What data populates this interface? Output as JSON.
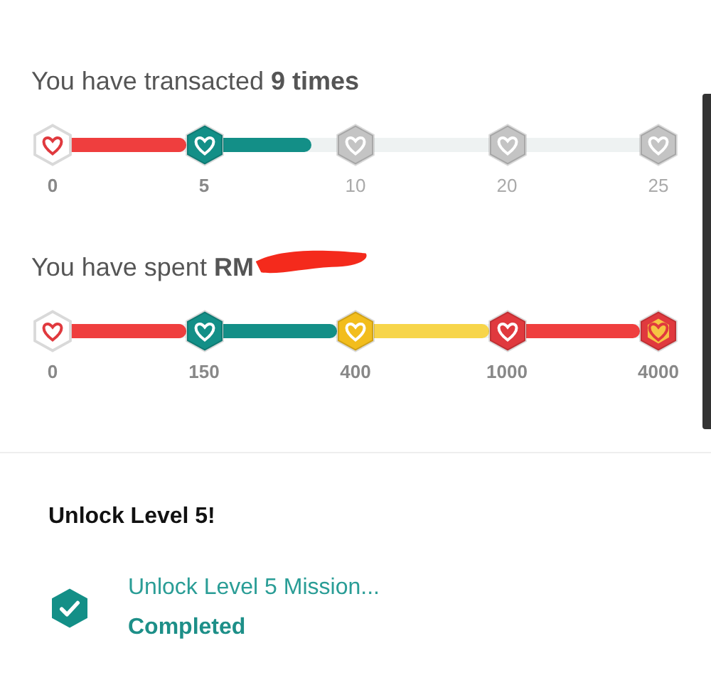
{
  "trackers": [
    {
      "title": "You have transacted **9 times**",
      "milestones": [
        {
          "label": "0",
          "kind": "outline",
          "achieved": true
        },
        {
          "label": "5",
          "kind": "filled",
          "color": "#138f87",
          "achieved": true
        },
        {
          "label": "10",
          "kind": "filled",
          "color": "#c4c4c4",
          "achieved": false
        },
        {
          "label": "20",
          "kind": "filled",
          "color": "#c4c4c4",
          "achieved": false
        },
        {
          "label": "25",
          "kind": "filled",
          "color": "#c4c4c4",
          "achieved": false
        }
      ],
      "segments": [
        {
          "color": "#ef3e3e",
          "level": 1
        },
        {
          "color": "#138f87",
          "level": 0.78
        },
        {
          "reached": false
        },
        {
          "reached": false
        }
      ]
    },
    {
      "title": "You have spent **RM**",
      "redacted": true,
      "milestones": [
        {
          "label": "0",
          "kind": "outline",
          "achieved": true
        },
        {
          "label": "150",
          "kind": "filled",
          "color": "#138f87",
          "achieved": true
        },
        {
          "label": "400",
          "kind": "filled",
          "color": "#f2bd1d",
          "achieved": true
        },
        {
          "label": "1000",
          "kind": "filled",
          "color": "#e0393e",
          "achieved": true
        },
        {
          "label": "4000",
          "kind": "gold",
          "color": "#e0393e",
          "achieved": true
        }
      ],
      "segments": [
        {
          "color": "#ef3e3e",
          "level": 1
        },
        {
          "color": "#138f87",
          "level": 1
        },
        {
          "color": "#f7d54a",
          "level": 1
        },
        {
          "color": "#ef3e3e",
          "level": 1
        }
      ]
    }
  ],
  "unlock": {
    "title": "Unlock Level 5!",
    "missions": [
      {
        "name": "Unlock Level 5 Mission...",
        "status": "Completed",
        "done": true
      }
    ]
  }
}
